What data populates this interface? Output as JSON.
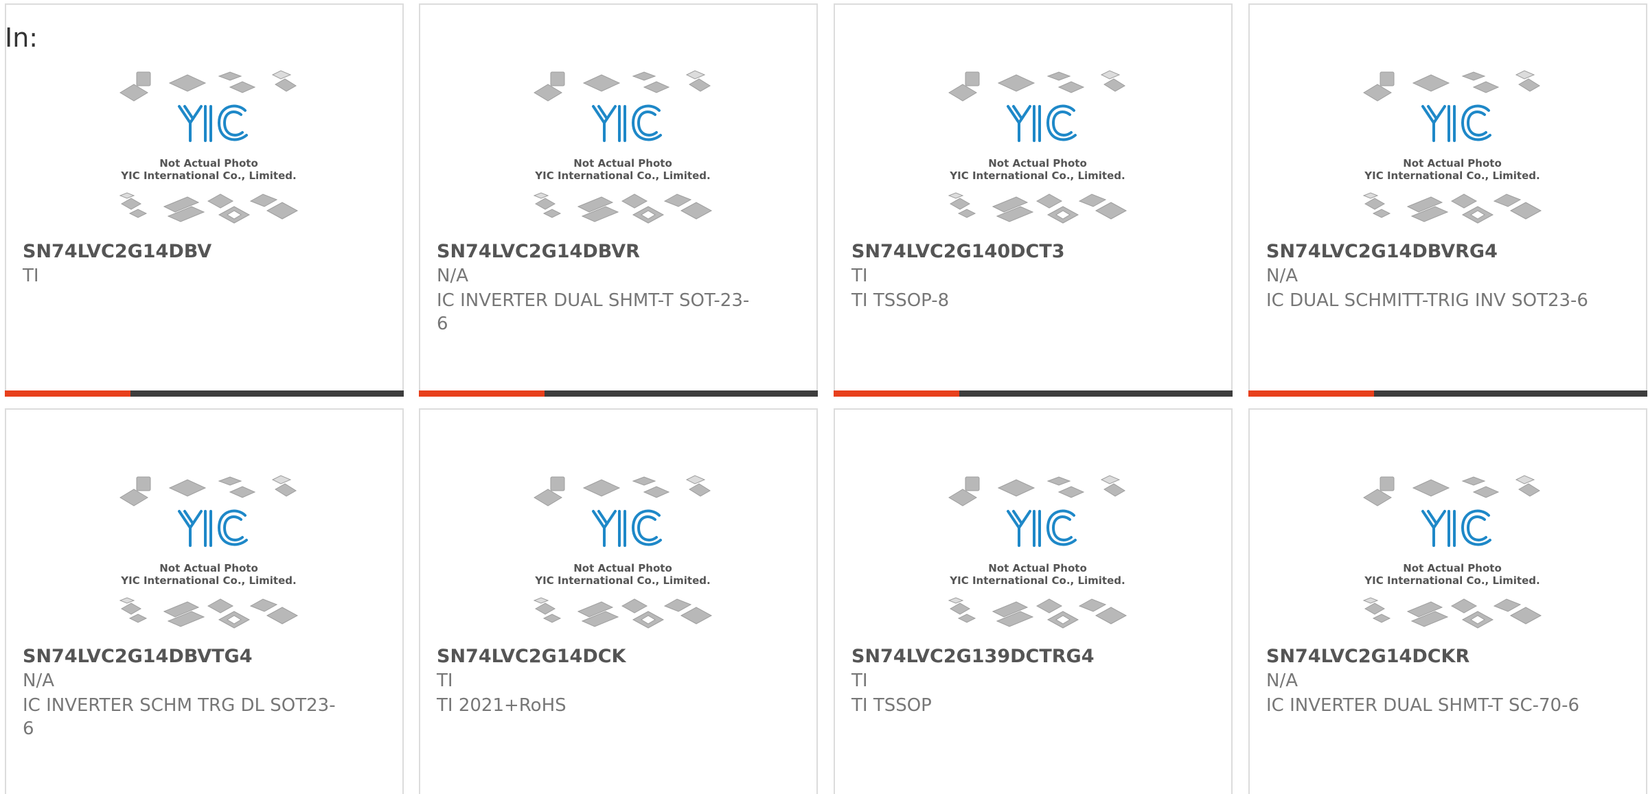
{
  "header": {
    "in_label": "In:"
  },
  "placeholder": {
    "line1": "Not Actual Photo",
    "line2": "YIC International Co., Limited.",
    "logo_text": "YIC",
    "logo_color": "#1e88c8"
  },
  "colors": {
    "accent": "#e8401c",
    "bar": "#3d3d3d",
    "border": "#dcdcdc"
  },
  "products": [
    {
      "part_number": "SN74LVC2G14DBV",
      "manufacturer": "TI",
      "description": ""
    },
    {
      "part_number": "SN74LVC2G14DBVR",
      "manufacturer": "N/A",
      "description": "IC INVERTER DUAL SHMT-T SOT-23-6"
    },
    {
      "part_number": "SN74LVC2G140DCT3",
      "manufacturer": "TI",
      "description": "TI TSSOP-8"
    },
    {
      "part_number": "SN74LVC2G14DBVRG4",
      "manufacturer": "N/A",
      "description": "IC DUAL SCHMITT-TRIG INV SOT23-6"
    },
    {
      "part_number": "SN74LVC2G14DBVTG4",
      "manufacturer": "N/A",
      "description": "IC INVERTER SCHM TRG DL SOT23-6"
    },
    {
      "part_number": "SN74LVC2G14DCK",
      "manufacturer": "TI",
      "description": "TI 2021+RoHS"
    },
    {
      "part_number": "SN74LVC2G139DCTRG4",
      "manufacturer": "TI",
      "description": "TI TSSOP"
    },
    {
      "part_number": "SN74LVC2G14DCKR",
      "manufacturer": "N/A",
      "description": "IC INVERTER DUAL SHMT-T SC-70-6"
    }
  ]
}
